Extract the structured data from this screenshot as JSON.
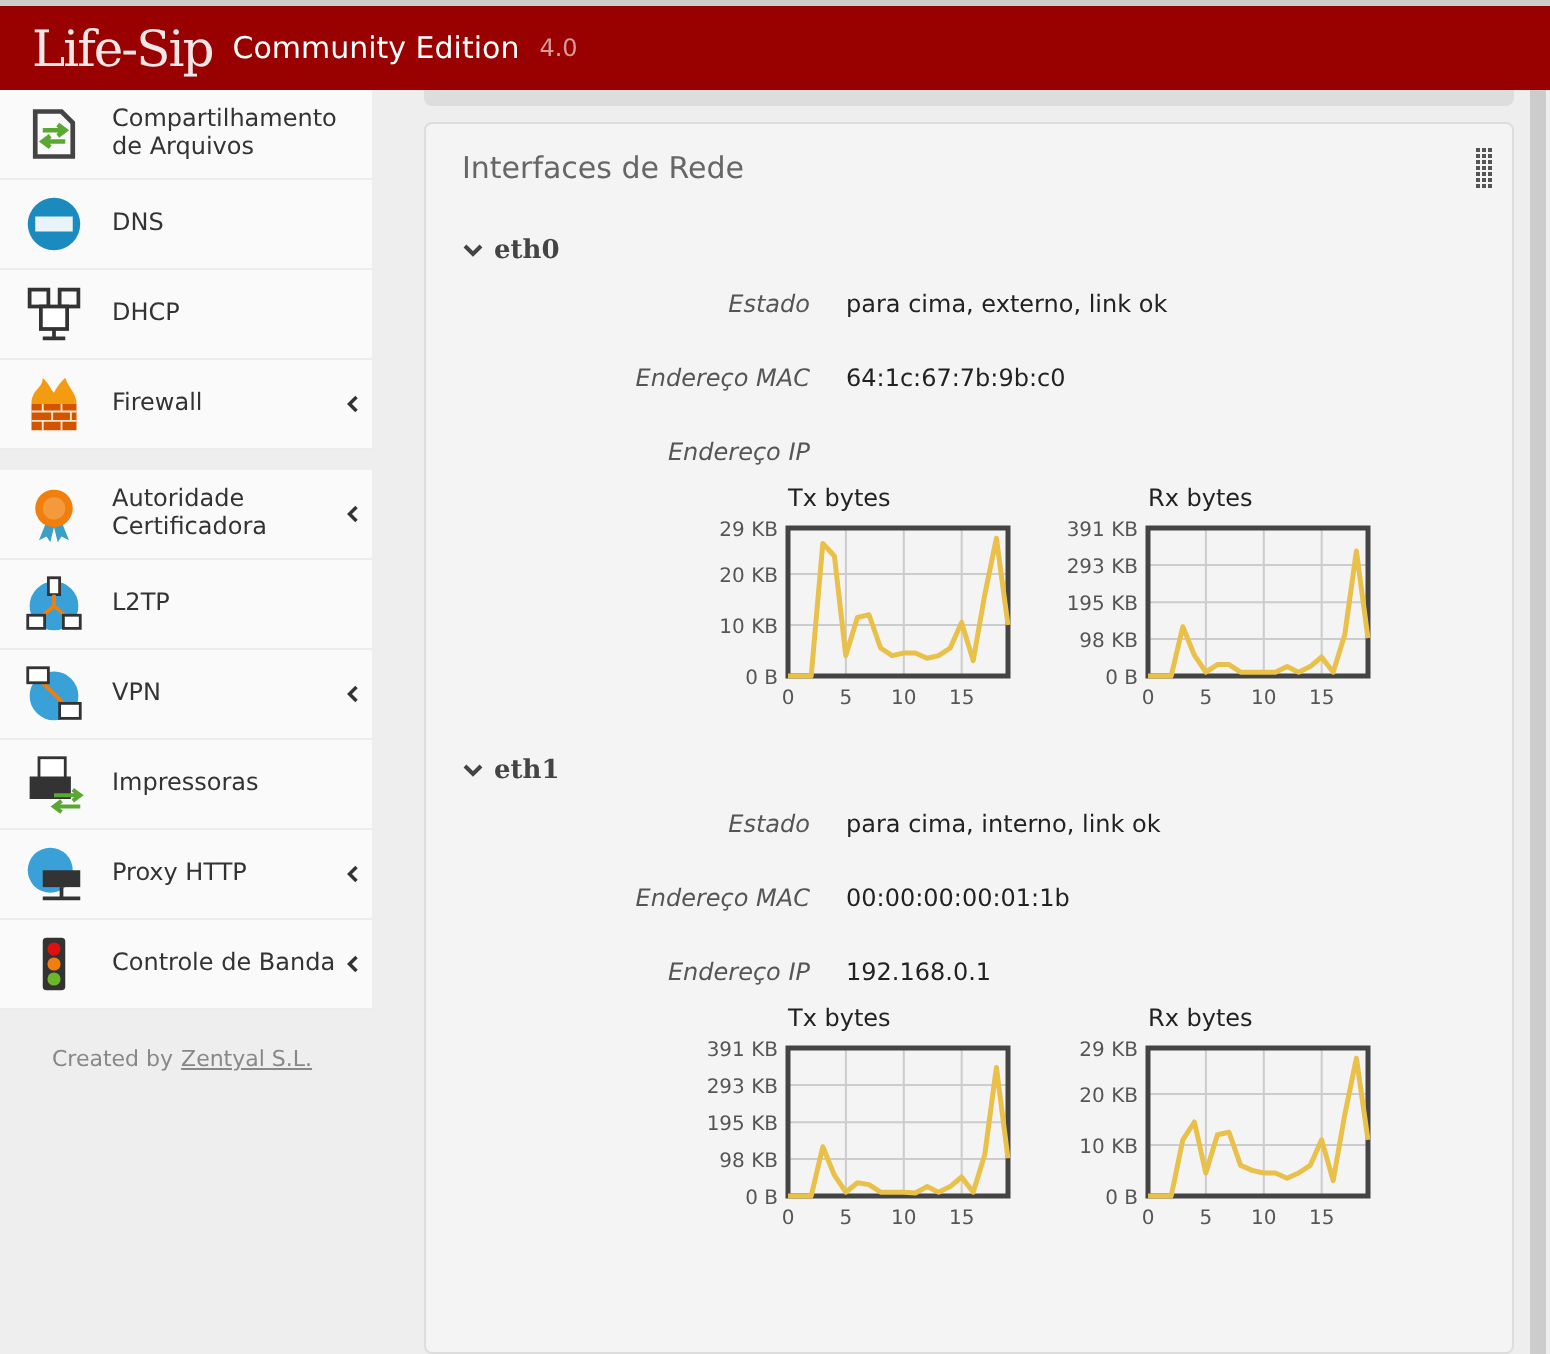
{
  "header": {
    "logo": "Life-Sip",
    "edition": "Community Edition",
    "version": "4.0"
  },
  "sidebar": {
    "groups": [
      [
        {
          "label": "Compartilhamento de Arquivos",
          "submenu": false
        },
        {
          "label": "DNS",
          "submenu": false
        },
        {
          "label": "DHCP",
          "submenu": false
        },
        {
          "label": "Firewall",
          "submenu": true
        }
      ],
      [
        {
          "label": "Autoridade Certificadora",
          "submenu": true
        },
        {
          "label": "L2TP",
          "submenu": false
        },
        {
          "label": "VPN",
          "submenu": true
        },
        {
          "label": "Impressoras",
          "submenu": false
        },
        {
          "label": "Proxy HTTP",
          "submenu": true
        },
        {
          "label": "Controle de Banda",
          "submenu": true
        }
      ]
    ],
    "footer": {
      "text": "Created by",
      "link": "Zentyal S.L."
    }
  },
  "panel": {
    "title": "Interfaces de Rede",
    "interfaces": [
      {
        "name": "eth0",
        "expanded": true,
        "fields": [
          {
            "label": "Estado",
            "value": "para cima, externo, link ok"
          },
          {
            "label": "Endereço MAC",
            "value": "64:1c:67:7b:9b:c0"
          },
          {
            "label": "Endereço IP"
          }
        ],
        "charts": [
          {
            "chart_data": {
              "type": "line",
              "title": "Tx bytes",
              "grid": true,
              "x": [
                0,
                1,
                2,
                3,
                4,
                5,
                6,
                7,
                8,
                9,
                10,
                11,
                12,
                13,
                14,
                15,
                16,
                17,
                18,
                19
              ],
              "series": [
                {
                  "color": "#e8c04a",
                  "values": [
                    0,
                    0,
                    0,
                    26,
                    23.5,
                    4,
                    11.5,
                    12,
                    5.5,
                    4,
                    4.5,
                    4.5,
                    3.5,
                    4,
                    5.5,
                    10.5,
                    3,
                    16,
                    27,
                    10
                  ]
                }
              ],
              "xlim": [
                0,
                19
              ],
              "ylim": [
                0,
                29
              ],
              "xticks": [
                0,
                5,
                10,
                15
              ],
              "yticks": [
                {
                  "value": 0,
                  "label": "0 B"
                },
                {
                  "value": 10,
                  "label": "10 KB"
                },
                {
                  "value": 20,
                  "label": "20 KB"
                },
                {
                  "value": 29,
                  "label": "29 KB"
                }
              ]
            }
          },
          {
            "chart_data": {
              "type": "line",
              "title": "Rx bytes",
              "grid": true,
              "x": [
                0,
                1,
                2,
                3,
                4,
                5,
                6,
                7,
                8,
                9,
                10,
                11,
                12,
                13,
                14,
                15,
                16,
                17,
                18,
                19
              ],
              "series": [
                {
                  "color": "#e8c04a",
                  "values": [
                    0,
                    0,
                    0,
                    130,
                    55,
                    10,
                    30,
                    30,
                    10,
                    10,
                    10,
                    10,
                    25,
                    10,
                    25,
                    50,
                    10,
                    110,
                    330,
                    100
                  ]
                }
              ],
              "xlim": [
                0,
                19
              ],
              "ylim": [
                0,
                391
              ],
              "xticks": [
                0,
                5,
                10,
                15
              ],
              "yticks": [
                {
                  "value": 0,
                  "label": "0 B"
                },
                {
                  "value": 98,
                  "label": "98 KB"
                },
                {
                  "value": 195,
                  "label": "195 KB"
                },
                {
                  "value": 293,
                  "label": "293 KB"
                },
                {
                  "value": 391,
                  "label": "391 KB"
                }
              ]
            }
          }
        ]
      },
      {
        "name": "eth1",
        "expanded": true,
        "fields": [
          {
            "label": "Estado",
            "value": "para cima, interno, link ok"
          },
          {
            "label": "Endereço MAC",
            "value": "00:00:00:00:01:1b"
          },
          {
            "label": "Endereço IP",
            "value": "192.168.0.1"
          }
        ],
        "charts": [
          {
            "chart_data": {
              "type": "line",
              "title": "Tx bytes",
              "grid": true,
              "x": [
                0,
                1,
                2,
                3,
                4,
                5,
                6,
                7,
                8,
                9,
                10,
                11,
                12,
                13,
                14,
                15,
                16,
                17,
                18,
                19
              ],
              "series": [
                {
                  "color": "#e8c04a",
                  "values": [
                    0,
                    0,
                    0,
                    130,
                    55,
                    10,
                    35,
                    30,
                    10,
                    10,
                    10,
                    8,
                    25,
                    10,
                    25,
                    50,
                    10,
                    110,
                    340,
                    100
                  ]
                }
              ],
              "xlim": [
                0,
                19
              ],
              "ylim": [
                0,
                391
              ],
              "xticks": [
                0,
                5,
                10,
                15
              ],
              "yticks": [
                {
                  "value": 0,
                  "label": "0 B"
                },
                {
                  "value": 98,
                  "label": "98 KB"
                },
                {
                  "value": 195,
                  "label": "195 KB"
                },
                {
                  "value": 293,
                  "label": "293 KB"
                },
                {
                  "value": 391,
                  "label": "391 KB"
                }
              ]
            }
          },
          {
            "chart_data": {
              "type": "line",
              "title": "Rx bytes",
              "grid": true,
              "x": [
                0,
                1,
                2,
                3,
                4,
                5,
                6,
                7,
                8,
                9,
                10,
                11,
                12,
                13,
                14,
                15,
                16,
                17,
                18,
                19
              ],
              "series": [
                {
                  "color": "#e8c04a",
                  "values": [
                    0,
                    0,
                    0,
                    11,
                    14.5,
                    4.5,
                    12,
                    12.5,
                    6,
                    5,
                    4.5,
                    4.5,
                    3.5,
                    4.5,
                    6,
                    11,
                    3,
                    16,
                    27,
                    11
                  ]
                }
              ],
              "xlim": [
                0,
                19
              ],
              "ylim": [
                0,
                29
              ],
              "xticks": [
                0,
                5,
                10,
                15
              ],
              "yticks": [
                {
                  "value": 0,
                  "label": "0 B"
                },
                {
                  "value": 10,
                  "label": "10 KB"
                },
                {
                  "value": 20,
                  "label": "20 KB"
                },
                {
                  "value": 29,
                  "label": "29 KB"
                }
              ]
            }
          }
        ]
      }
    ]
  }
}
